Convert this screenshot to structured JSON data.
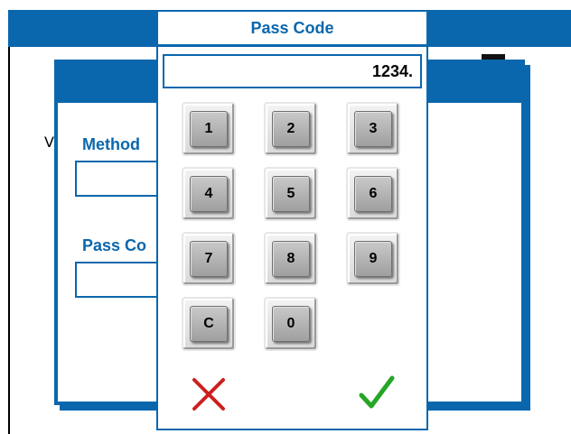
{
  "background_form": {
    "method_label": "Method",
    "passcode_label": "Pass Co",
    "left_fragment": "V"
  },
  "modal": {
    "title": "Pass Code",
    "display_value": "1234.",
    "keys": [
      "1",
      "2",
      "3",
      "4",
      "5",
      "6",
      "7",
      "8",
      "9",
      "C",
      "0"
    ],
    "cancel_icon": "red-x-icon",
    "confirm_icon": "green-check-icon"
  },
  "colors": {
    "accent": "#0a67ad",
    "cancel": "#cc1f1f",
    "confirm": "#26a626"
  }
}
